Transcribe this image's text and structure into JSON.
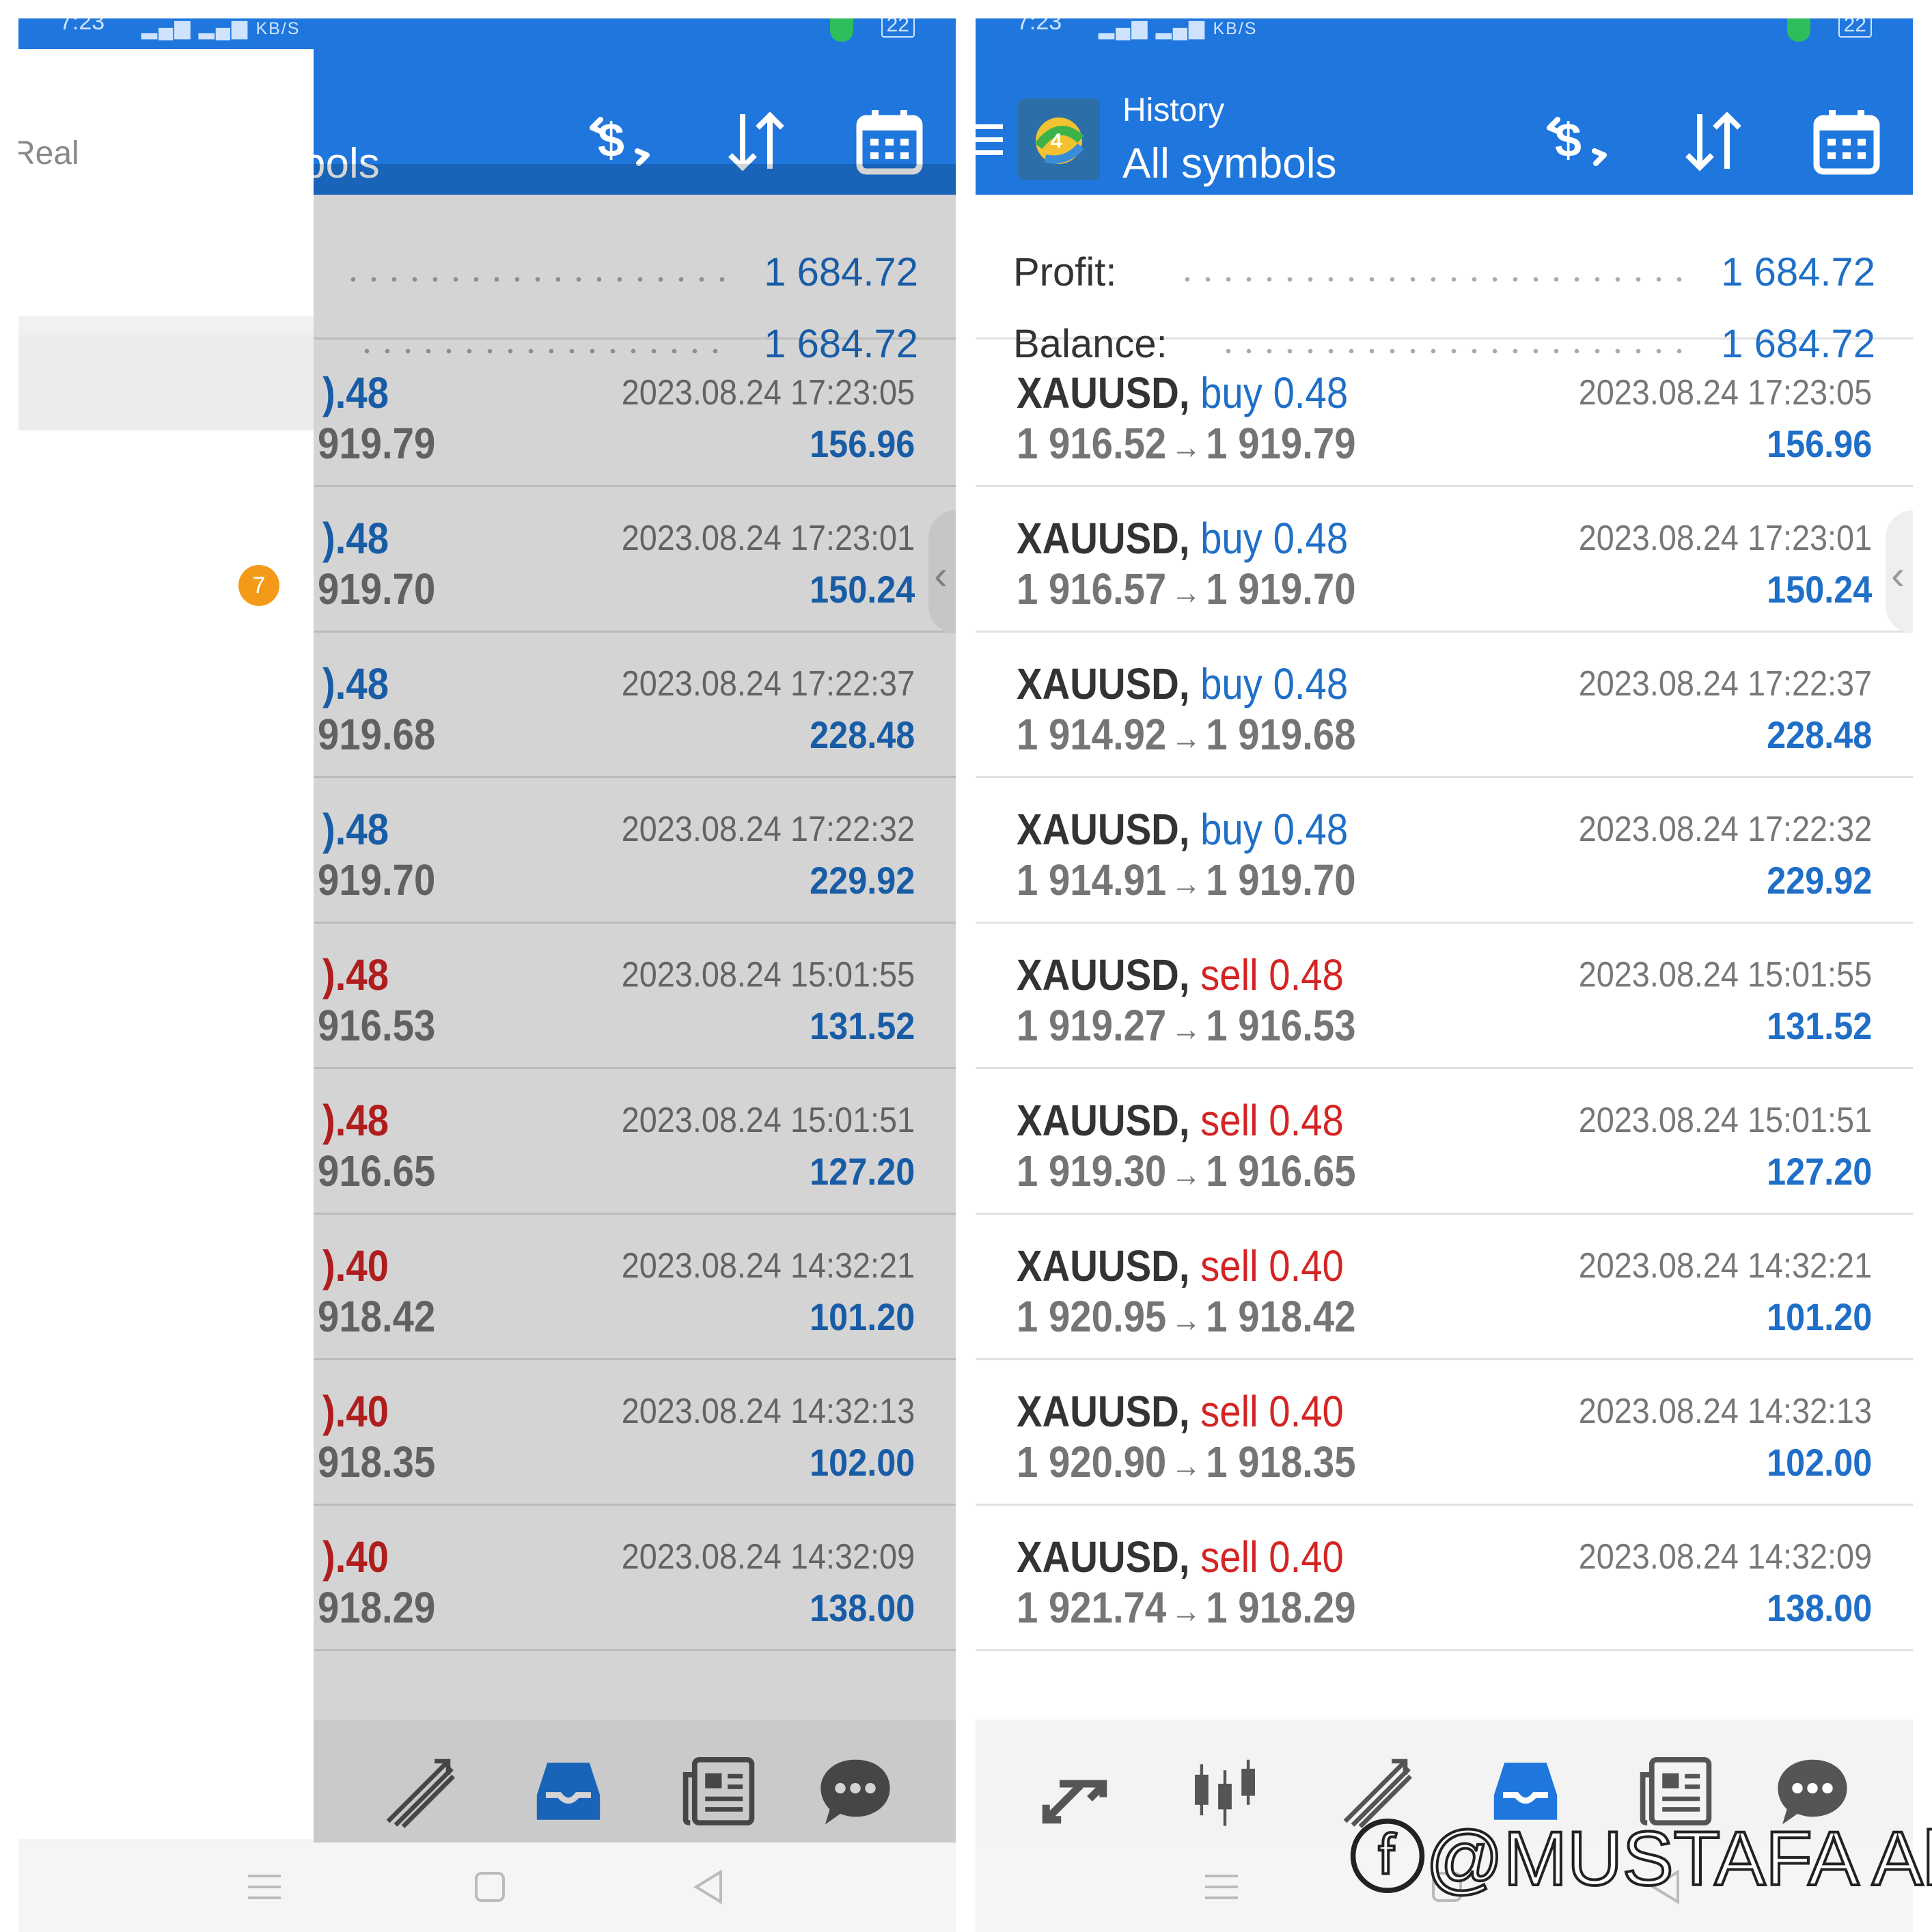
{
  "status": {
    "time": "7:23",
    "net": "KB/S",
    "battery": "22"
  },
  "header": {
    "subtitle": "History",
    "title": "All symbols",
    "title_cropped": "bols"
  },
  "drawer": {
    "account_label": "Real",
    "badge": "7"
  },
  "summary": {
    "profit_label": "Profit:",
    "profit_value": "1 684.72",
    "balance_label": "Balance:",
    "balance_value": "1 684.72"
  },
  "trades": [
    {
      "symbol": "XAUUSD,",
      "type": "buy",
      "volume": "0.48",
      "volume_cropped": ").48",
      "open": "1 916.52",
      "close": "1 919.79",
      "close_cropped": "919.79",
      "time": "2023.08.24 17:23:05",
      "profit": "156.96"
    },
    {
      "symbol": "XAUUSD,",
      "type": "buy",
      "volume": "0.48",
      "volume_cropped": ").48",
      "open": "1 916.57",
      "close": "1 919.70",
      "close_cropped": "919.70",
      "time": "2023.08.24 17:23:01",
      "profit": "150.24"
    },
    {
      "symbol": "XAUUSD,",
      "type": "buy",
      "volume": "0.48",
      "volume_cropped": ").48",
      "open": "1 914.92",
      "close": "1 919.68",
      "close_cropped": "919.68",
      "time": "2023.08.24 17:22:37",
      "profit": "228.48"
    },
    {
      "symbol": "XAUUSD,",
      "type": "buy",
      "volume": "0.48",
      "volume_cropped": ").48",
      "open": "1 914.91",
      "close": "1 919.70",
      "close_cropped": "919.70",
      "time": "2023.08.24 17:22:32",
      "profit": "229.92"
    },
    {
      "symbol": "XAUUSD,",
      "type": "sell",
      "volume": "0.48",
      "volume_cropped": ").48",
      "open": "1 919.27",
      "close": "1 916.53",
      "close_cropped": "916.53",
      "time": "2023.08.24 15:01:55",
      "profit": "131.52"
    },
    {
      "symbol": "XAUUSD,",
      "type": "sell",
      "volume": "0.48",
      "volume_cropped": ").48",
      "open": "1 919.30",
      "close": "1 916.65",
      "close_cropped": "916.65",
      "time": "2023.08.24 15:01:51",
      "profit": "127.20"
    },
    {
      "symbol": "XAUUSD,",
      "type": "sell",
      "volume": "0.40",
      "volume_cropped": ").40",
      "open": "1 920.95",
      "close": "1 918.42",
      "close_cropped": "918.42",
      "time": "2023.08.24 14:32:21",
      "profit": "101.20"
    },
    {
      "symbol": "XAUUSD,",
      "type": "sell",
      "volume": "0.40",
      "volume_cropped": ").40",
      "open": "1 920.90",
      "close": "1 918.35",
      "close_cropped": "918.35",
      "time": "2023.08.24 14:32:13",
      "profit": "102.00"
    },
    {
      "symbol": "XAUUSD,",
      "type": "sell",
      "volume": "0.40",
      "volume_cropped": ").40",
      "open": "1 921.74",
      "close": "1 918.29",
      "close_cropped": "918.29",
      "time": "2023.08.24 14:32:09",
      "profit": "138.00"
    }
  ],
  "arrow_glyph": "→",
  "tabs": [
    "quotes-icon",
    "chart-icon",
    "trade-icon",
    "history-icon",
    "news-icon",
    "chat-icon"
  ],
  "colors": {
    "header": "#1f77de",
    "buy": "#1f6fc8",
    "sell": "#d42424",
    "profit": "#1f6fc8"
  },
  "watermark": "ⓕ@MUSTAFA Ali"
}
